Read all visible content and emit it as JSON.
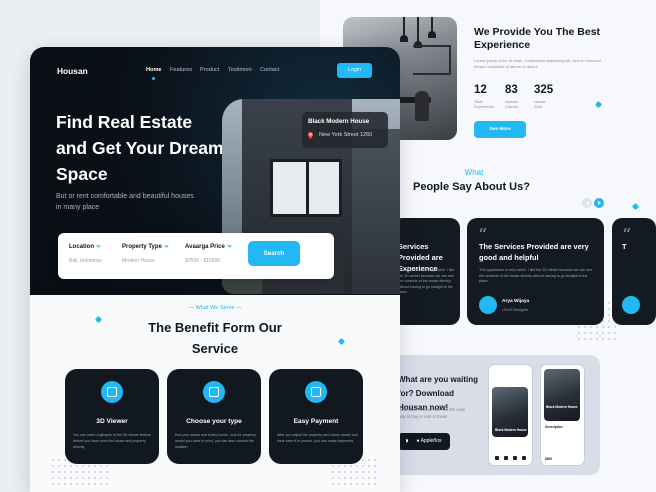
{
  "colors": {
    "accent": "#21b8f3",
    "dark": "#121820",
    "hero": "#0b1119",
    "light": "#f9fafc"
  },
  "background_page": {
    "experience_title": "We Provide You The Best Experience",
    "experience_text": "Lorem ipsum dolor sit amet, consectetur adipiscing elit, sed do eiusmod tempor incididunt ut labore et dolore",
    "stats": [
      {
        "value": "12",
        "label": "Total Experience"
      },
      {
        "value": "83",
        "label": "Awards Gained"
      },
      {
        "value": "325",
        "label": "House Sold"
      }
    ],
    "see_more": "See More",
    "what_label": "What",
    "testimonial_title": "People Say About Us?",
    "testimonials": [
      {
        "title": "Services Provided are Experience",
        "text": "This application is very useful. I like the 3D viewer because we can see the contents of the house directly without having to go straight to the place."
      },
      {
        "title": "The Services Provided are very good and helpful",
        "text": "This application is very useful. I like the 3D viewer because we can see the contents of the house directly without having to go straight to the place.",
        "name": "Arya Wijaya",
        "role": "UI/UX Designer"
      },
      {
        "title": "T",
        "text": ""
      }
    ],
    "cta_title": "What are you waiting for? Download Housan now!",
    "cta_text": "Download Housan and feel the easy way to buy or rent a house",
    "store_label": "Appleños",
    "phone_labels": {
      "phone1_title": "Black Modern House",
      "phone2_title": "Black Modern House",
      "phone2_price": "$500",
      "description_label": "Description"
    }
  },
  "front": {
    "logo": "Housan",
    "nav": [
      "Home",
      "Features",
      "Product",
      "Testimoni",
      "Contact"
    ],
    "login": "Login",
    "hero_title": "Find Real Estate and Get Your Dream Space",
    "hero_subtitle": "But or rent comfortable and beautiful houses in many place",
    "badge_title": "Black Modern House",
    "badge_address": "New York Street 1260",
    "search": {
      "fields": [
        {
          "label": "Location",
          "value": "Bali, Indonesia"
        },
        {
          "label": "Property Type",
          "value": "Modern House"
        },
        {
          "label": "Avaarga Price",
          "value": "$7500 - $10000"
        }
      ],
      "button": "Search"
    },
    "serve_label": "— What We Serve —",
    "benefit_title": "The Benefit Form Our Service",
    "benefits": [
      {
        "title": "3D Viewer",
        "text": "You can catch a glimpse of the 3D viewer feature before you have seen the house and property directly",
        "icon": "cube-hand-icon"
      },
      {
        "title": "Choose your type",
        "text": "find your dream and lovely house, look for property model you have in mind, you can also choose the location",
        "icon": "grid-select-icon"
      },
      {
        "title": "Easy Payment",
        "text": "After you adjust the property and house model and have seen it in person, you can make payments.",
        "icon": "wallet-icon"
      }
    ]
  }
}
